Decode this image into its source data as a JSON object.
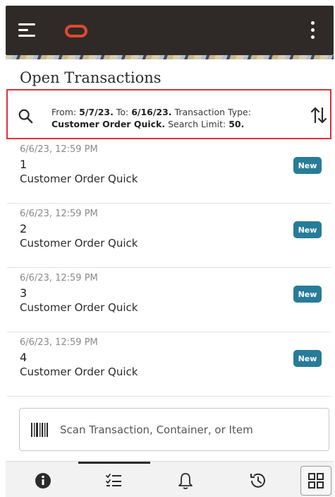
{
  "header": {
    "menu_icon": "hamburger-icon",
    "logo_icon": "oracle-logo",
    "more_icon": "kebab-menu-icon",
    "logo_color": "#e2482f"
  },
  "page": {
    "title": "Open Transactions"
  },
  "search_summary": {
    "from_label": "From:",
    "from_value": "5/7/23.",
    "to_label": "To:",
    "to_value": "6/16/23.",
    "type_label": "Transaction Type:",
    "type_value": "Customer Order Quick.",
    "limit_label": "Search Limit:",
    "limit_value": "50.",
    "highlight_color": "#e0313b"
  },
  "transactions": [
    {
      "timestamp": "6/6/23, 12:59 PM",
      "number": "1",
      "type": "Customer Order Quick",
      "status": "New"
    },
    {
      "timestamp": "6/6/23, 12:59 PM",
      "number": "2",
      "type": "Customer Order Quick",
      "status": "New"
    },
    {
      "timestamp": "6/6/23, 12:59 PM",
      "number": "3",
      "type": "Customer Order Quick",
      "status": "New"
    },
    {
      "timestamp": "6/6/23, 12:59 PM",
      "number": "4",
      "type": "Customer Order Quick",
      "status": "New"
    }
  ],
  "badge_color": "#277c99",
  "scan": {
    "placeholder": "Scan Transaction, Container, or Item",
    "icon": "barcode-icon"
  },
  "bottom_nav": {
    "items": [
      "info-icon",
      "checklist-icon",
      "bell-icon",
      "history-icon",
      "grid-icon"
    ],
    "active": "checklist-icon"
  }
}
